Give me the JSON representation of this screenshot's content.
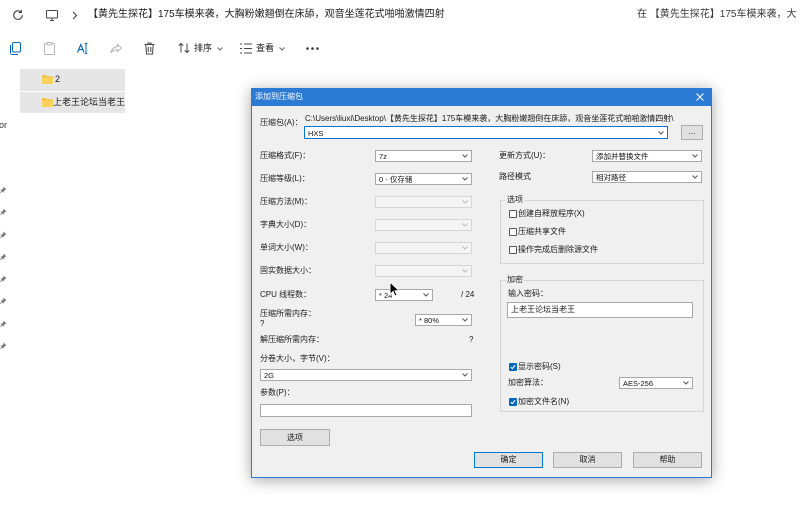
{
  "theme": {
    "title_bar": "#2b7ad3",
    "accent": "#0067c0",
    "folder": "#f3c142"
  },
  "explorer": {
    "address": {
      "refresh_icon": "refresh-icon",
      "location_icon": "monitor-icon",
      "path": "【黄先生探花】175车模来袭，大胸粉嫩翘倒在床舔，观音坐莲花式啪啪激情四射",
      "search_text": "在 【黄先生探花】175车模来袭，大"
    },
    "toolbar": {
      "icons": [
        "copy-icon",
        "paste-icon",
        "rename-icon",
        "share-icon",
        "delete-icon"
      ],
      "sort_label": "排序",
      "view_label": "查看"
    },
    "nav_pane_fragment": "or",
    "folders": [
      {
        "name": "2",
        "icon": "folder-icon"
      },
      {
        "name": "上老王论坛当老王",
        "icon": "folder-icon"
      }
    ]
  },
  "dialog": {
    "title": "添加到压缩包",
    "archive": {
      "label": "压缩包(A)：",
      "folder_path": "C:\\Users\\liuxi\\Desktop\\【黄先生探花】175车模来袭，大胸粉嫩翘倒在床舔，观音坐莲花式啪啪激情四射\\",
      "name": "HXS",
      "browse_label": "..."
    },
    "left": {
      "format": {
        "label": "压缩格式(F)：",
        "value": "7z"
      },
      "level": {
        "label": "压缩等级(L)：",
        "value": "0 - 仅存储"
      },
      "method": {
        "label": "压缩方法(M)："
      },
      "dictionary": {
        "label": "字典大小(D)："
      },
      "word": {
        "label": "单词大小(W)："
      },
      "solid": {
        "label": "固实数据大小："
      },
      "threads": {
        "label": "CPU 线程数：",
        "value": "* 24",
        "max": "/ 24"
      },
      "compress_memory": {
        "label": "压缩所需内存：",
        "value": "?",
        "limit": "* 80%"
      },
      "decompress_memory": {
        "label": "解压缩所需内存：",
        "value": "?"
      },
      "volume": {
        "label": "分卷大小，字节(V)：",
        "value": "2G"
      },
      "parameters": {
        "label": "参数(P)："
      },
      "options_button": "选项"
    },
    "right": {
      "update_mode": {
        "label": "更新方式(U)：",
        "value": "添加并替换文件"
      },
      "path_mode": {
        "label": "路径模式",
        "value": "相对路径"
      },
      "options": {
        "title": "选项",
        "checkboxes": [
          {
            "label": "创建自释放程序(X)",
            "checked": false
          },
          {
            "label": "压缩共享文件",
            "checked": false
          },
          {
            "label": "操作完成后删除源文件",
            "checked": false
          }
        ]
      },
      "encryption": {
        "title": "加密",
        "password_label": "输入密码：",
        "password": "上老王论坛当老王",
        "show_password": {
          "label": "显示密码(S)",
          "checked": true
        },
        "method_label": "加密算法：",
        "method": "AES-256",
        "encrypt_names": {
          "label": "加密文件名(N)",
          "checked": true
        }
      }
    },
    "buttons": {
      "ok": "确定",
      "cancel": "取消",
      "help": "帮助"
    }
  }
}
